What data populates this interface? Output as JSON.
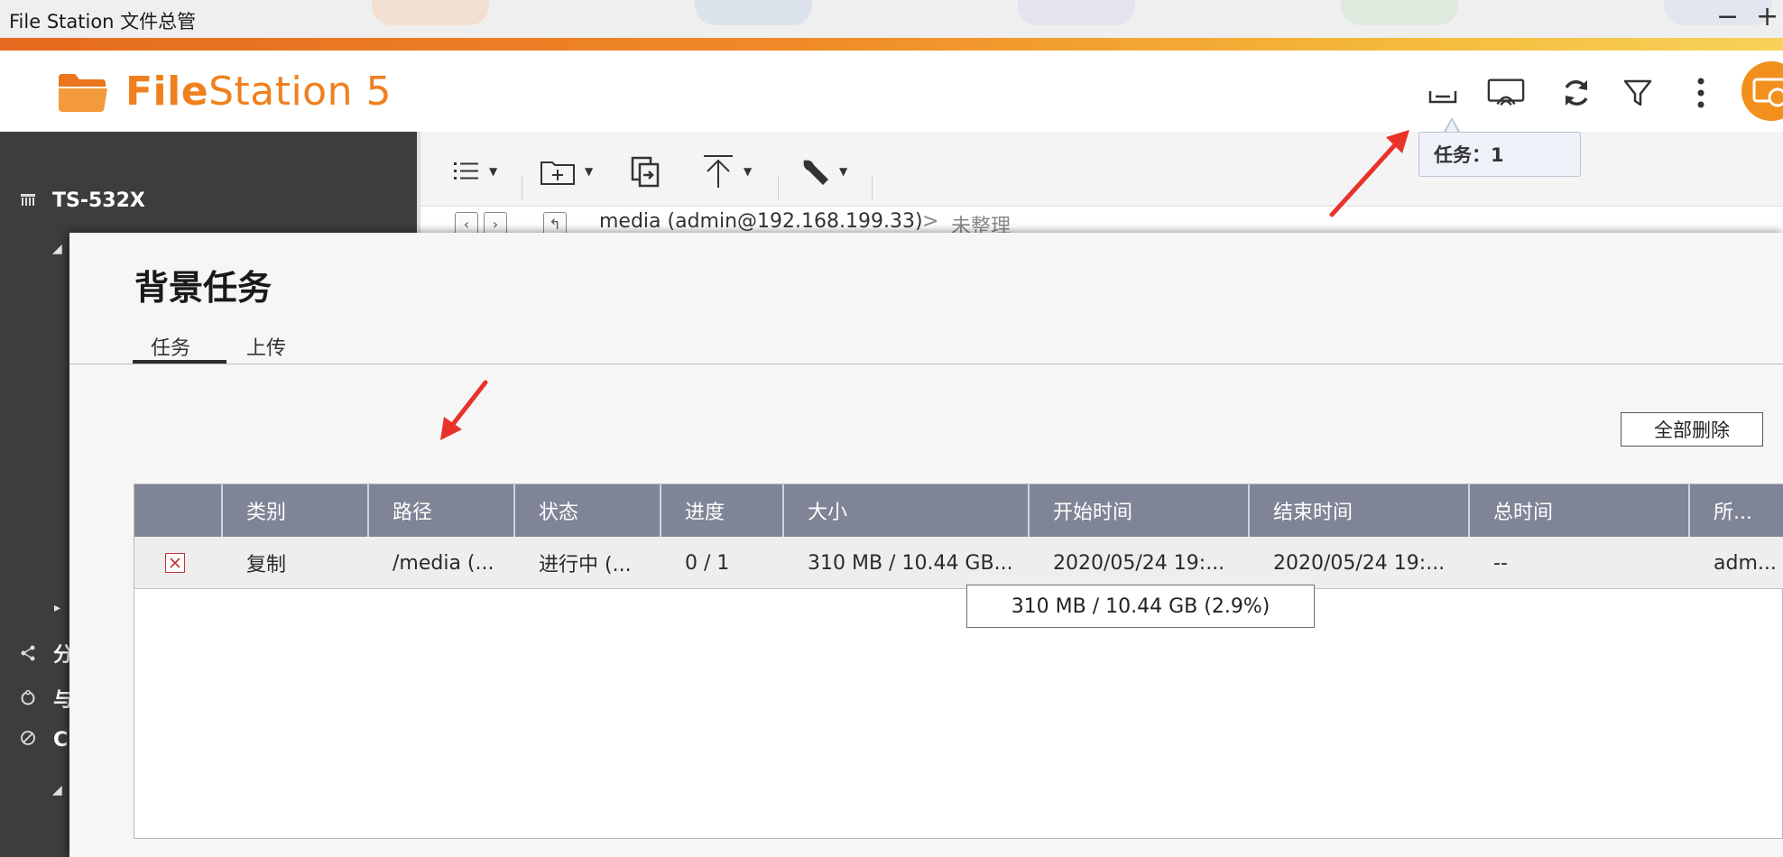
{
  "window": {
    "title": "File Station 文件总管",
    "minimize_glyph": "−",
    "maximize_glyph": "+"
  },
  "header": {
    "app_name_bold": "File",
    "app_name_rest": "Station 5",
    "icons": [
      "background-tasks-icon",
      "cast-icon",
      "refresh-icon",
      "filter-icon",
      "more-menu-icon",
      "avatar-icon"
    ]
  },
  "task_tooltip": "任务：1",
  "sidebar": {
    "server_name": "TS-532X",
    "items": [
      {
        "icon": "share-icon",
        "label": "分"
      },
      {
        "icon": "sync-icon",
        "label": "与"
      },
      {
        "icon": "cloud-icon",
        "label": "Cl"
      }
    ]
  },
  "toolbar": {
    "icons": [
      "list-view-icon",
      "new-folder-icon",
      "copy-icon",
      "upload-icon",
      "tools-icon"
    ]
  },
  "pathbar": {
    "path": "media (admin@192.168.199.33)",
    "sep": ">",
    "folder": "未整理"
  },
  "dialog": {
    "title": "背景任务",
    "tabs": [
      {
        "label": "任务",
        "active": true
      },
      {
        "label": "上传",
        "active": false
      }
    ],
    "delete_all_label": "全部删除",
    "table": {
      "columns": [
        "",
        "类别",
        "路径",
        "状态",
        "进度",
        "大小",
        "开始时间",
        "结束时间",
        "总时间",
        "所..."
      ],
      "rows": [
        {
          "type": "复制",
          "path": "/media (...",
          "status": "进行中 (...",
          "progress": "0 / 1",
          "size": "310 MB / 10.44 GB...",
          "start_time": "2020/05/24 19:...",
          "end_time": "2020/05/24 19:...",
          "total_time": "--",
          "owner": "adm..."
        }
      ]
    },
    "size_tooltip": "310 MB / 10.44 GB (2.9%)"
  },
  "colors": {
    "brand_orange": "#f0801f",
    "annotation_red": "#e8322a",
    "header_row": "#7f8596",
    "sidebar": "#3d3d3d"
  }
}
